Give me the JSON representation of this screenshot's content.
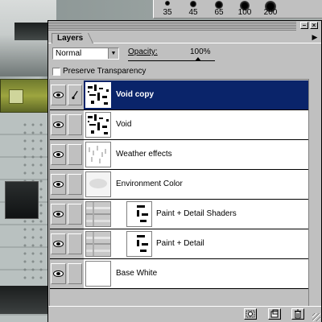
{
  "brushes": [
    {
      "label": "35",
      "size": 6
    },
    {
      "label": "45",
      "size": 8
    },
    {
      "label": "65",
      "size": 10
    },
    {
      "label": "100",
      "size": 12
    },
    {
      "label": "200",
      "size": 14
    }
  ],
  "palette": {
    "tab_label": "Layers",
    "blend_mode": "Normal",
    "opacity_label": "Opacity:",
    "opacity_value": "100%",
    "opacity_level": 1.0,
    "preserve_transparency_label": "Preserve Transparency",
    "preserve_transparency_checked": false,
    "selection_color": "#0a246a"
  },
  "layers": [
    {
      "name": "Void copy",
      "selected": true,
      "visible": true,
      "brush": true,
      "mask": false
    },
    {
      "name": "Void",
      "selected": false,
      "visible": true,
      "brush": false,
      "mask": false
    },
    {
      "name": "Weather effects",
      "selected": false,
      "visible": true,
      "brush": false,
      "mask": false
    },
    {
      "name": "Environment Color",
      "selected": false,
      "visible": true,
      "brush": false,
      "mask": false
    },
    {
      "name": "Paint + Detail Shaders",
      "selected": false,
      "visible": true,
      "brush": false,
      "mask": true
    },
    {
      "name": "Paint + Detail",
      "selected": false,
      "visible": true,
      "brush": false,
      "mask": true
    },
    {
      "name": "Base White",
      "selected": false,
      "visible": true,
      "brush": false,
      "mask": false
    }
  ],
  "icons": {
    "visibility": "eye-icon",
    "paint": "brush-icon",
    "new_layer": "new-layer-icon",
    "delete_layer": "trash-icon",
    "new_mask": "mask-icon",
    "palette_menu": "triangle-right-icon",
    "minimize": "minimize-icon",
    "close": "close-icon"
  }
}
